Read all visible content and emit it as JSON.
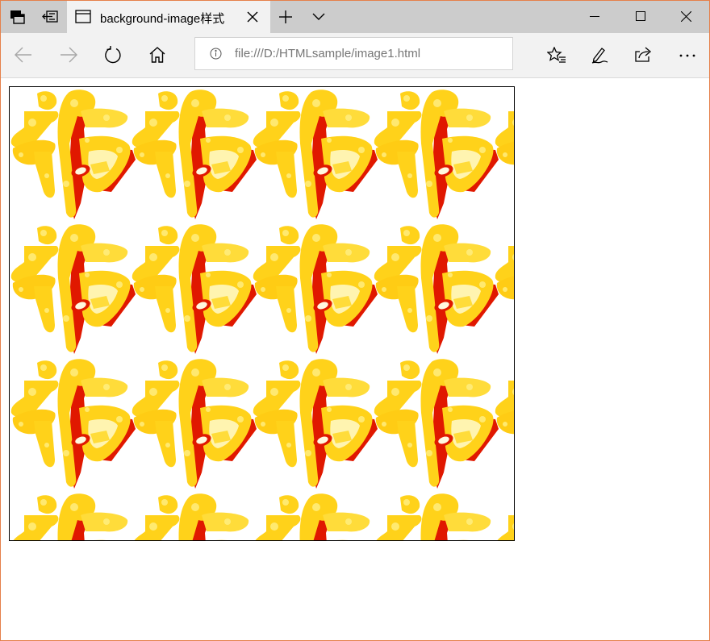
{
  "tab": {
    "title": "background-image样式",
    "tab_icon": "page-icon",
    "close_icon": "close-icon"
  },
  "titlebar": {
    "left_icons": [
      "tab-overview-icon",
      "set-aside-tabs-icon"
    ],
    "new_tab_icon": "plus-icon",
    "tab_list_icon": "chevron-down-icon",
    "window_controls": [
      "minimize-icon",
      "maximize-icon",
      "close-icon"
    ]
  },
  "toolbar": {
    "nav_icons": [
      "back-arrow-icon",
      "forward-arrow-icon",
      "refresh-icon",
      "home-icon"
    ],
    "right_icons": [
      "favorites-icon",
      "pen-icon",
      "share-icon",
      "more-icon"
    ]
  },
  "address_bar": {
    "info_icon": "info-icon",
    "url": "file:///D:/HTMLsample/image1.html"
  },
  "content": {
    "tile_image": "fu-character-tile",
    "colors": {
      "gold": "#ffd21a",
      "light_gold": "#ffe866",
      "red": "#e01800",
      "border": "#000000"
    }
  }
}
